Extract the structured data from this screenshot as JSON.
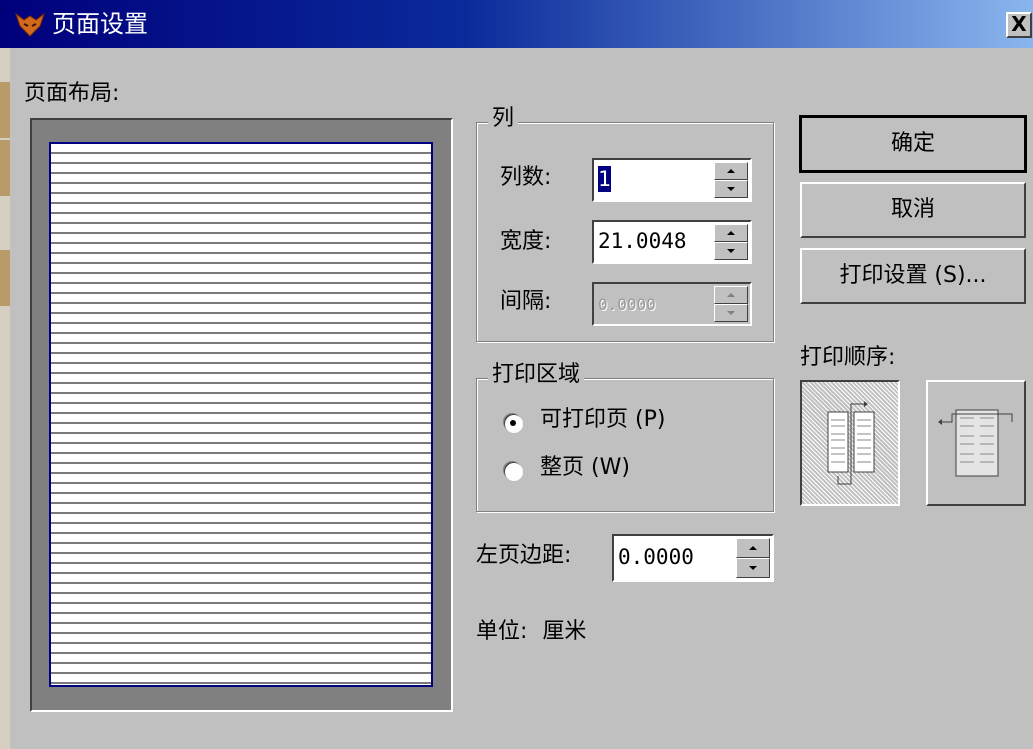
{
  "dialog": {
    "title": "页面设置",
    "close_label": "X"
  },
  "layout": {
    "label": "页面布局:"
  },
  "columns_group": {
    "title": "列",
    "count_label": "列数:",
    "count_value": "1",
    "width_label": "宽度:",
    "width_value": "21.0048",
    "spacing_label": "间隔:",
    "spacing_value": "0.0000"
  },
  "print_area_group": {
    "title": "打印区域",
    "options": [
      {
        "label": "可打印页 (P)",
        "checked": true
      },
      {
        "label": "整页 (W)",
        "checked": false
      }
    ]
  },
  "left_margin": {
    "label": "左页边距:",
    "value": "0.0000"
  },
  "units": {
    "label": "单位:",
    "value": "厘米"
  },
  "buttons": {
    "ok": "确定",
    "cancel": "取消",
    "print_setup": "打印设置 (S)..."
  },
  "print_order": {
    "label": "打印顺序:",
    "options": [
      {
        "icon": "top-to-bottom-order-icon",
        "selected": true
      },
      {
        "icon": "left-to-right-order-icon",
        "selected": false
      }
    ]
  },
  "colors": {
    "title_start": "#00007b",
    "title_end": "#8ab6ee",
    "face": "#c0c0c0",
    "selection": "#000080"
  }
}
